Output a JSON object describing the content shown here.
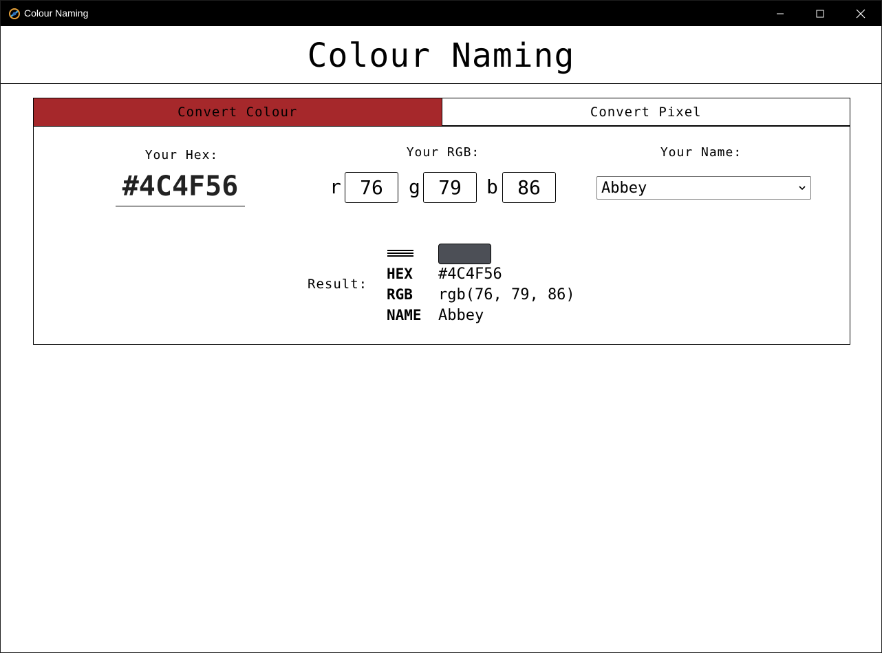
{
  "window": {
    "title": "Colour Naming"
  },
  "header": {
    "title": "Colour Naming"
  },
  "tabs": [
    {
      "label": "Convert Colour",
      "active": true
    },
    {
      "label": "Convert Pixel",
      "active": false
    }
  ],
  "hex": {
    "label": "Your Hex:",
    "value": "#4C4F56"
  },
  "rgb": {
    "label": "Your RGB:",
    "channels": [
      {
        "letter": "r",
        "value": "76"
      },
      {
        "letter": "g",
        "value": "79"
      },
      {
        "letter": "b",
        "value": "86"
      }
    ]
  },
  "name": {
    "label": "Your Name:",
    "selected": "Abbey"
  },
  "result": {
    "label": "Result:",
    "swatch_color": "#4C4F56",
    "rows": [
      {
        "key": "HEX",
        "value": "#4C4F56"
      },
      {
        "key": "RGB",
        "value": "rgb(76, 79, 86)"
      },
      {
        "key": "NAME",
        "value": "Abbey"
      }
    ]
  },
  "colors": {
    "titlebar": "#000000",
    "active_tab": "#a6282b"
  }
}
